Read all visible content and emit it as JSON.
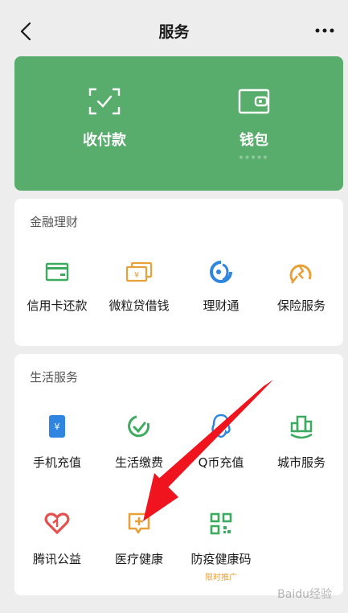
{
  "header": {
    "title": "服务"
  },
  "wallet_card": {
    "pay": {
      "label": "收付款",
      "icon": "scan-pay-icon"
    },
    "wallet": {
      "label": "钱包",
      "balance_mask": "*****",
      "icon": "wallet-icon"
    }
  },
  "finance": {
    "title": "金融理财",
    "items": [
      {
        "label": "信用卡还款",
        "icon": "credit-card-icon"
      },
      {
        "label": "微粒贷借钱",
        "icon": "loan-icon"
      },
      {
        "label": "理财通",
        "icon": "wealth-icon"
      },
      {
        "label": "保险服务",
        "icon": "insurance-icon"
      }
    ]
  },
  "life": {
    "title": "生活服务",
    "items": [
      {
        "label": "手机充值",
        "icon": "phone-recharge-icon"
      },
      {
        "label": "生活缴费",
        "icon": "utility-payment-icon"
      },
      {
        "label": "Q币充值",
        "icon": "qq-coin-icon"
      },
      {
        "label": "城市服务",
        "icon": "city-service-icon"
      },
      {
        "label": "腾讯公益",
        "icon": "charity-icon"
      },
      {
        "label": "医疗健康",
        "icon": "medical-icon"
      },
      {
        "label": "防疫健康码",
        "icon": "health-code-icon",
        "badge": "限时推广"
      }
    ]
  },
  "watermark": "Baidu经验",
  "colors": {
    "green": "#58ad6d",
    "icon_green": "#3cab5f",
    "icon_orange": "#e8a138",
    "icon_blue": "#2f86e0",
    "icon_red": "#e5514f",
    "arrow_red": "#f0141e"
  }
}
